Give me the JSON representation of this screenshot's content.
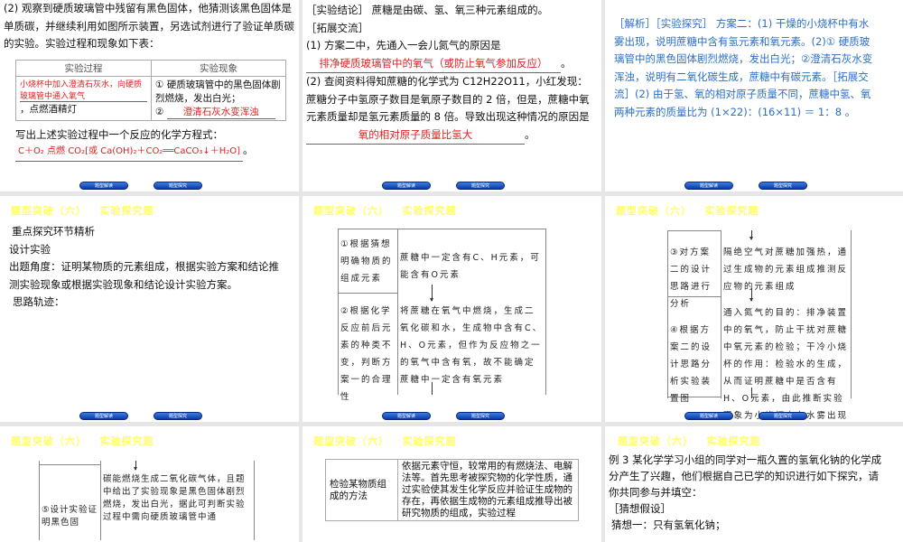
{
  "nav": {
    "btn1": "题型解读",
    "btn2": "题型探究"
  },
  "header": "题型突破（六）   实验探究题",
  "s1": {
    "p": "(2) 观察到硬质玻璃管中残留有黑色固体，他猜测该黑色固体是单质碳，并继续利用如图所示装置，另选试剂进行了验证单质碳的实验。实验过程和现象如下表：",
    "th1": "实验过程",
    "th2": "实验现象",
    "ans1": "小烧杯中加入澄清石灰水，向硬质玻璃管中通入氧气",
    "proc_tail": "，点燃酒精灯",
    "obs1": "① 硬质玻璃管中的黑色固体剧烈燃烧，发出白光；",
    "obs2_num": "②",
    "ans2": "澄清石灰水变浑浊",
    "q": "写出上述实验过程中一个反应的化学方程式：",
    "ans3": "C＋O₂ 点燃 CO₂[或 Ca(OH)₂＋CO₂══CaCO₃↓＋H₂O]",
    "end": "。"
  },
  "s2": {
    "l1": "［实验结论］ 蔗糖是由碳、氢、氧三种元素组成的。",
    "l2": "［拓展交流］",
    "l3": "(1) 方案二中，先通入一会儿氮气的原因是",
    "ans1": "排净硬质玻璃管中的氧气（或防止氧气参加反应）",
    "l4": "(2) 查阅资料得知蔗糖的化学式为 C12H22O11，小红发现：蔗糖分子中氢原子数目是氧原子数目的 2 倍，但是，蔗糖中氧元素质量却是氢元素质量的 8 倍。导致出现这种情况的原因是",
    "ans2": "氧的相对原子质量比氢大",
    "end": "。"
  },
  "s3": {
    "text": "［解析］［实验探究］ 方案二：(1) 干燥的小烧杯中有水雾出现，说明蔗糖中含有氢元素和氧元素。(2)① 硬质玻璃管中的黑色固体剧烈燃烧，发出白光；②澄清石灰水变浑浊，说明有二氧化碳生成，蔗糖中有碳元素。［拓展交流］(2) 由于氢、氧的相对原子质量不同，蔗糖中氢、氧两种元素的质量比为 (1×22)：(16×11) ＝ 1：8 。"
  },
  "s4": {
    "l1": "重点探究环节精析",
    "l2": "设计实验",
    "l3": "出题角度：证明某物质的元素组成，根据实验方案和结论推测实验现象或根据实验现象和结论设计实验方案。",
    "l4": "思路轨迹："
  },
  "s5": {
    "left1": "①根据猜想明确物质的组成元素",
    "right1": "蔗糖中一定含有C、H元素，可能含有O元素",
    "left2": "②根据化学反应前后元素的种类不变，判断方案一的合理性",
    "right2": "将蔗糖在氧气中燃烧，生成二氧化碳和水，生成物中含有C、H、O元素，但作为反应物之一的氧气中含有氧，故不能确定蔗糖中一定含有氧元素"
  },
  "s6": {
    "left1": "③对方案二的设计思路进行分析",
    "right1": "隔绝空气对蔗糖加强热，通过生成物的元素组成推测反应物的元素组成",
    "left2": "④根据方案二的设计思路分析实验装置图",
    "right2": "通入氮气的目的：排净装置中的氧气，防止干扰对蔗糖中氧元素的检验；干冷小烧杯的作用：检验水的生成，从而证明蔗糖中是否含有H、O元素，由此推断实验现象为小烧杯中有水雾出现"
  },
  "s7": {
    "left": "⑤设计实验证明黑色固",
    "right": "碳能燃烧生成二氧化碳气体，且题中给出了实验现象是黑色固体剧烈燃烧，发出白光，据此可判断实验过程中需向硬质玻璃管中通"
  },
  "s8": {
    "left": "检验某物质组成的方法",
    "right": "依据元素守恒，较常用的有燃烧法、电解法等。首先思考被探究物的化学性质，通过实验使其发生化学反应并验证生成物的存在，再依据生成物的元素组成推导出被研究物质的组成，实验过程"
  },
  "s9": {
    "l1": "例 3  某化学学习小组的同学对一瓶久置的氢氧化钠的化学成分产生了兴趣，他们根据自己已学的知识进行如下探究，请你共同参与并填空：",
    "l2": "［猜想假设］",
    "l3": "猜想一：只有氢氧化钠；"
  }
}
